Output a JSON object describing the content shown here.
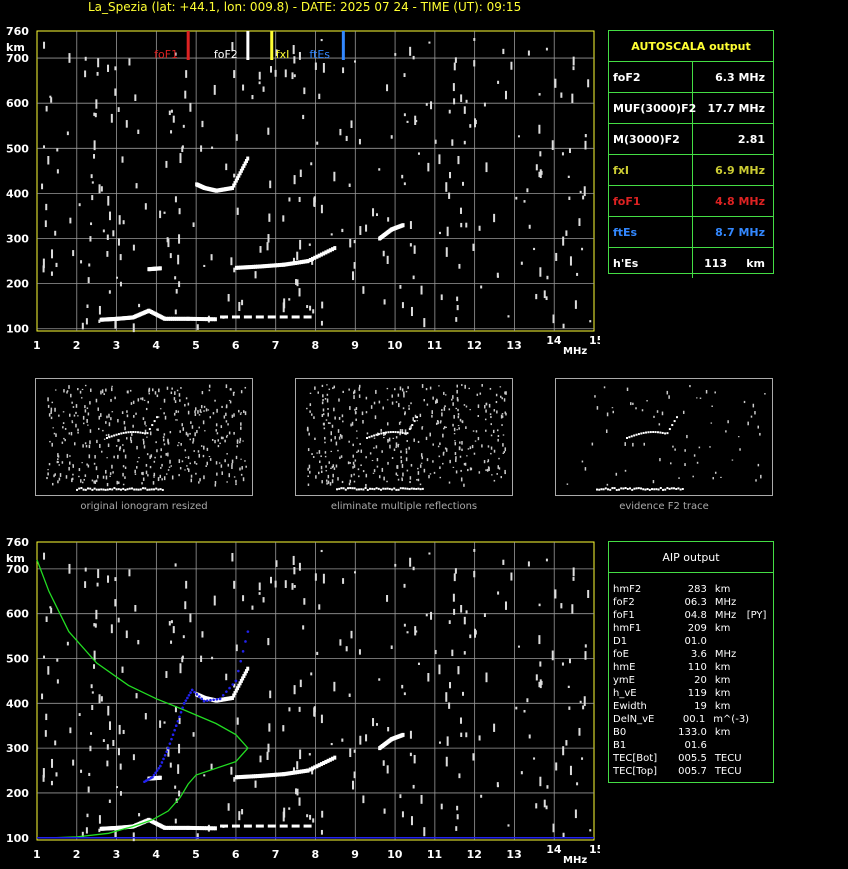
{
  "header": {
    "title": "La_Spezia (lat: +44.1, lon: 009.8) - DATE: 2025 07 24 - TIME (UT): 09:15"
  },
  "colors": {
    "grid": "#999999",
    "axis": "#ffff33",
    "foF1": "#dd2222",
    "foF2": "#ffffff",
    "fxI": "#ffff33",
    "ftEs": "#3388ff",
    "profile": "#22dd22",
    "model": "#2222ee",
    "panel_border": "#44dd44"
  },
  "axes": {
    "y_unit": "km",
    "x_unit": "MHz",
    "x_ticks": [
      "1",
      "2",
      "3",
      "4",
      "5",
      "6",
      "7",
      "8",
      "9",
      "10",
      "11",
      "12",
      "13",
      "14",
      "15"
    ],
    "y_ticks": [
      "760",
      "700",
      "600",
      "500",
      "400",
      "300",
      "200",
      "100"
    ]
  },
  "markers": [
    {
      "label": "foF1",
      "freq": 4.8,
      "color": "#dd2222"
    },
    {
      "label": "foF2",
      "freq": 6.3,
      "color": "#ffffff"
    },
    {
      "label": "fxI",
      "freq": 6.9,
      "color": "#ffff33"
    },
    {
      "label": "ftEs",
      "freq": 8.7,
      "color": "#3388ff"
    }
  ],
  "autoscala": {
    "title": "AUTOSCALA output",
    "rows": [
      {
        "label": "foF2",
        "value": "6.3 MHz",
        "color": "#ffffff"
      },
      {
        "label": "MUF(3000)F2",
        "value": "17.7 MHz",
        "color": "#ffffff"
      },
      {
        "label": "M(3000)F2",
        "value": "2.81",
        "color": "#ffffff"
      },
      {
        "label": "fxI",
        "value": "6.9 MHz",
        "color": "#cccc33"
      },
      {
        "label": "foF1",
        "value": "4.8 MHz",
        "color": "#dd2222"
      },
      {
        "label": "ftEs",
        "value": "8.7 MHz",
        "color": "#3388ff"
      },
      {
        "label": "h'Es",
        "value": "113     km",
        "color": "#ffffff"
      }
    ]
  },
  "thumbnails": [
    {
      "caption": "original ionogram resized"
    },
    {
      "caption": "eliminate multiple reflections"
    },
    {
      "caption": "evidence F2 trace"
    }
  ],
  "aip": {
    "title": "AIP output",
    "rows": [
      [
        "hmF2",
        "283",
        "km",
        ""
      ],
      [
        "foF2",
        "06.3",
        "MHz",
        ""
      ],
      [
        "foF1",
        "04.8",
        "MHz",
        "[PY]"
      ],
      [
        "hmF1",
        "209",
        "km",
        ""
      ],
      [
        "D1",
        "01.0",
        "",
        ""
      ],
      [
        "foE",
        "3.6",
        "MHz",
        ""
      ],
      [
        "hmE",
        "110",
        "km",
        ""
      ],
      [
        "ymE",
        "20",
        "km",
        ""
      ],
      [
        "h_vE",
        "119",
        "km",
        ""
      ],
      [
        "Ewidth",
        "19",
        "km",
        ""
      ],
      [
        "DelN_vE",
        "00.1",
        "m^(-3)",
        ""
      ],
      [
        "B0",
        "133.0",
        "km",
        ""
      ],
      [
        "B1",
        "01.6",
        "",
        ""
      ],
      [
        "TEC[Bot]",
        "005.5",
        "TECU",
        ""
      ],
      [
        "TEC[Top]",
        "005.7",
        "TECU",
        ""
      ]
    ]
  },
  "chart_data": [
    {
      "type": "scatter",
      "title": "",
      "xlabel": "MHz",
      "ylabel": "km",
      "xlim": [
        1,
        15
      ],
      "ylim": [
        95,
        760
      ],
      "grid": true,
      "series": [
        {
          "points": [
            [
              2.6,
              120
            ],
            [
              3,
              122
            ],
            [
              3.4,
              125
            ],
            [
              3.8,
              140
            ],
            [
              4.2,
              122
            ],
            [
              4.8,
              122
            ],
            [
              5.5,
              121
            ]
          ]
        },
        {
          "points": [
            [
              3.8,
              232
            ],
            [
              4.1,
              234
            ]
          ]
        },
        {
          "points": [
            [
              5.0,
              420
            ],
            [
              5.2,
              412
            ],
            [
              5.5,
              406
            ],
            [
              5.9,
              412
            ],
            [
              6.3,
              480
            ]
          ]
        },
        {
          "points": [
            [
              6,
              235
            ],
            [
              6.6,
              238
            ],
            [
              7.2,
              242
            ],
            [
              7.8,
              250
            ],
            [
              8.5,
              280
            ]
          ]
        },
        {
          "points": [
            [
              9.6,
              300
            ],
            [
              9.9,
              320
            ],
            [
              10.2,
              330
            ]
          ]
        }
      ]
    },
    {
      "type": "line",
      "title": "",
      "xlabel": "MHz",
      "ylabel": "km",
      "xlim": [
        1,
        15
      ],
      "ylim": [
        95,
        760
      ],
      "grid": true,
      "series": [
        {
          "x": [
            1.0,
            1.3,
            1.8,
            2.5,
            3.3,
            4.0,
            4.7,
            5.5,
            6.0,
            6.3,
            6.0,
            5.0,
            4.8,
            4.6,
            4.3,
            3.9,
            3.4,
            2.8,
            2.0,
            1.4,
            1.0
          ],
          "y": [
            720,
            650,
            560,
            490,
            440,
            410,
            385,
            355,
            330,
            300,
            270,
            240,
            220,
            190,
            160,
            140,
            125,
            110,
            102,
            100,
            100
          ]
        },
        {
          "x": [
            3.7,
            3.9,
            4.1,
            4.3,
            4.5,
            4.7,
            4.9,
            5.2,
            5.6,
            6.0,
            6.3
          ],
          "y": [
            225,
            235,
            260,
            300,
            350,
            400,
            430,
            405,
            410,
            450,
            560
          ]
        }
      ]
    }
  ]
}
